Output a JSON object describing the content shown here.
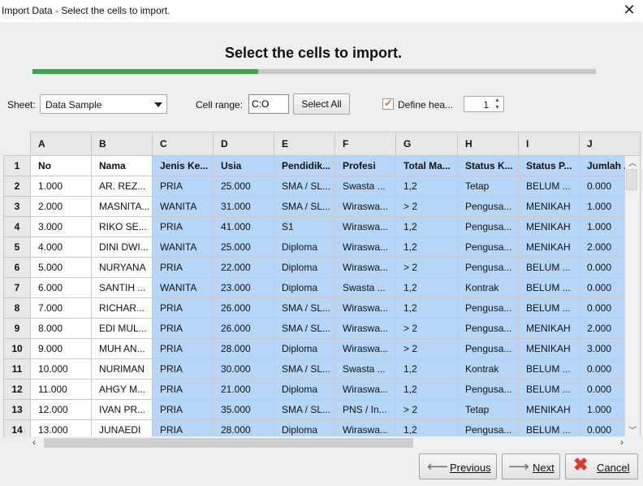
{
  "window": {
    "title": "Import Data - Select the cells to import."
  },
  "wizard": {
    "heading": "Select the cells to import.",
    "progress": 0.4
  },
  "controls": {
    "sheet_label": "Sheet:",
    "sheet_value": "Data Sample",
    "cell_range_label": "Cell range:",
    "cell_range_value": "C:O",
    "select_all_label": "Select All",
    "define_header_label": "Define hea...",
    "define_header_checked": true,
    "header_row_value": "1"
  },
  "grid": {
    "columns": [
      "A",
      "B",
      "C",
      "D",
      "E",
      "F",
      "G",
      "H",
      "I",
      "J"
    ],
    "rows": [
      {
        "n": "1",
        "cells": [
          "No",
          "Nama",
          "Jenis Ke...",
          "Usia",
          "Pendidik...",
          "Profesi",
          "Total Ma...",
          "Status K...",
          "Status P...",
          "Jumlah ..."
        ]
      },
      {
        "n": "2",
        "cells": [
          "1.000",
          "AR. REZ...",
          "PRIA",
          "25.000",
          "SMA / SL...",
          "Swasta ...",
          "1,2",
          "Tetap",
          "BELUM ...",
          "0.000"
        ]
      },
      {
        "n": "3",
        "cells": [
          "2.000",
          "MASNITA...",
          "WANITA",
          "31.000",
          "SMA / SL...",
          "Wiraswa...",
          "> 2",
          "Pengusa...",
          "MENIKAH",
          "1.000"
        ]
      },
      {
        "n": "4",
        "cells": [
          "3.000",
          "RIKO SE...",
          "PRIA",
          "41.000",
          "S1",
          "Wiraswa...",
          "1,2",
          "Pengusa...",
          "MENIKAH",
          "1.000"
        ]
      },
      {
        "n": "5",
        "cells": [
          "4.000",
          "DINI DWI...",
          "WANITA",
          "25.000",
          "Diploma",
          "Wiraswa...",
          "1,2",
          "Pengusa...",
          "MENIKAH",
          "2.000"
        ]
      },
      {
        "n": "6",
        "cells": [
          "5.000",
          "NURYANA",
          "PRIA",
          "22.000",
          "Diploma",
          "Wiraswa...",
          "> 2",
          "Pengusa...",
          "BELUM ...",
          "0.000"
        ]
      },
      {
        "n": "7",
        "cells": [
          "6.000",
          "SANTIH ...",
          "WANITA",
          "23.000",
          "Diploma",
          "Swasta ...",
          "1,2",
          "Kontrak",
          "BELUM ...",
          "0.000"
        ]
      },
      {
        "n": "8",
        "cells": [
          "7.000",
          "RICHAR...",
          "PRIA",
          "26.000",
          "SMA / SL...",
          "Wiraswa...",
          "1,2",
          "Pengusa...",
          "BELUM ...",
          "0.000"
        ]
      },
      {
        "n": "9",
        "cells": [
          "8.000",
          "EDI MUL...",
          "PRIA",
          "26.000",
          "SMA / SL...",
          "Wiraswa...",
          "> 2",
          "Pengusa...",
          "MENIKAH",
          "2.000"
        ]
      },
      {
        "n": "10",
        "cells": [
          "9.000",
          "MUH AN...",
          "PRIA",
          "28.000",
          "Diploma",
          "Wiraswa...",
          "> 2",
          "Pengusa...",
          "MENIKAH",
          "3.000"
        ]
      },
      {
        "n": "11",
        "cells": [
          "10.000",
          "NURIMAN",
          "PRIA",
          "30.000",
          "SMA / SL...",
          "Swasta ...",
          "1,2",
          "Kontrak",
          "BELUM ...",
          "0.000"
        ]
      },
      {
        "n": "12",
        "cells": [
          "11.000",
          "AHGY M...",
          "PRIA",
          "21.000",
          "Diploma",
          "Wiraswa...",
          "1,2",
          "Pengusa...",
          "BELUM ...",
          "0.000"
        ]
      },
      {
        "n": "13",
        "cells": [
          "12.000",
          "IVAN PR...",
          "PRIA",
          "35.000",
          "SMA / SL...",
          "PNS / In...",
          "> 2",
          "Tetap",
          "MENIKAH",
          "1.000"
        ]
      },
      {
        "n": "14",
        "cells": [
          "13.000",
          "JUNAEDI",
          "PRIA",
          "28.000",
          "Diploma",
          "Wiraswa...",
          "1,2",
          "Pengusa...",
          "BELUM ...",
          "0.000"
        ]
      }
    ],
    "selected_from_col": 2
  },
  "buttons": {
    "previous": "Previous",
    "next": "Next",
    "cancel": "Cancel"
  },
  "colors": {
    "selection": "#b6d6f7",
    "progress": "#3aa84a"
  }
}
